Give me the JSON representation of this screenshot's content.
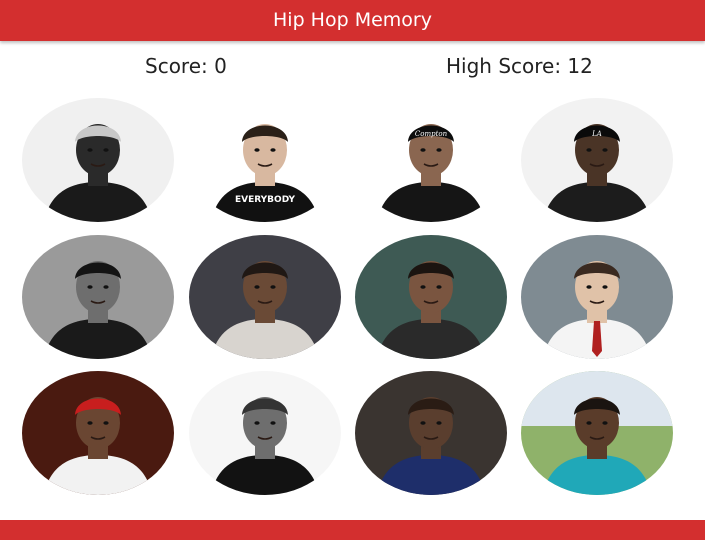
{
  "header": {
    "title": "Hip Hop Memory"
  },
  "scoreboard": {
    "score_label": "Score: 0",
    "high_score_label": "High Score: 12"
  },
  "cards": [
    {
      "name": "card-1",
      "icon": "portrait-crown-icon",
      "bg": "#f0f0f0",
      "skin": "#2a2a2a",
      "shirt": "#1a1a1a",
      "hat": "#c8c8c8"
    },
    {
      "name": "card-2",
      "icon": "portrait-everybody-icon",
      "bg": "#ffffff",
      "skin": "#d8b8a0",
      "shirt": "#111111",
      "hat": "#2a2018",
      "shirt_text": "EVERYBODY"
    },
    {
      "name": "card-3",
      "icon": "portrait-compton-cap-icon",
      "bg": "#ffffff",
      "skin": "#8a6650",
      "shirt": "#151515",
      "hat": "#0d0d0d",
      "hat_text": "Compton"
    },
    {
      "name": "card-4",
      "icon": "portrait-la-cap-icon",
      "bg": "#f2f2f2",
      "skin": "#4a3426",
      "shirt": "#1c1c1c",
      "hat": "#0a0a0a",
      "hat_text": "LA"
    },
    {
      "name": "card-5",
      "icon": "portrait-backwards-cap-icon",
      "bg": "#9a9a9a",
      "skin": "#6e6e6e",
      "shirt": "#1a1a1a",
      "hat": "#141414"
    },
    {
      "name": "card-6",
      "icon": "portrait-portrait-icon",
      "bg": "#3f3f46",
      "skin": "#6a4a36",
      "shirt": "#d8d4cf",
      "hat": "#201814"
    },
    {
      "name": "card-7",
      "icon": "portrait-dreads-icon",
      "bg": "#3e5a54",
      "skin": "#7a5540",
      "shirt": "#2a2a2a",
      "hat": "#1b1410"
    },
    {
      "name": "card-8",
      "icon": "portrait-white-shirt-icon",
      "bg": "#7f8b92",
      "skin": "#e0c2a8",
      "shirt": "#f4f4f4",
      "hat": "#3a2a20",
      "tie": "#b02020"
    },
    {
      "name": "card-9",
      "icon": "portrait-red-cap-icon",
      "bg": "#4a1a10",
      "skin": "#6a4632",
      "shirt": "#f2f2f2",
      "hat": "#c81e1e"
    },
    {
      "name": "card-10",
      "icon": "portrait-black-tee-icon",
      "bg": "#f6f6f6",
      "skin": "#6e6e6e",
      "shirt": "#121212",
      "hat": "#333333"
    },
    {
      "name": "card-11",
      "icon": "portrait-plaid-shirt-icon",
      "bg": "#3a3430",
      "skin": "#5a3e2e",
      "shirt": "#1e2e6a",
      "hat": "#2a1c14"
    },
    {
      "name": "card-12",
      "icon": "portrait-outdoor-icon",
      "bg": "#8fb26a",
      "skin": "#5a3c2a",
      "shirt": "#20a8b8",
      "hat": "#1a1410",
      "sky": "#dde6ee"
    }
  ]
}
